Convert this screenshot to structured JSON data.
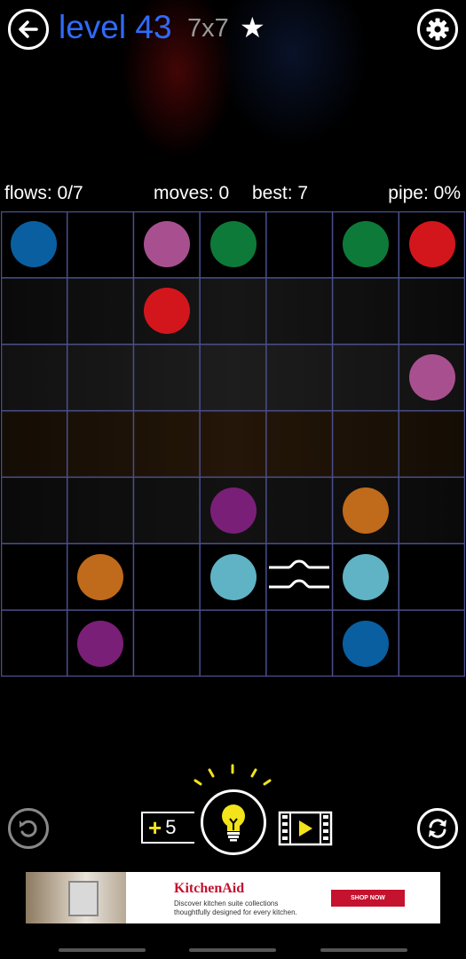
{
  "header": {
    "level_label": "level 43",
    "board_size": "7x7",
    "star": "★",
    "back_icon": "arrow-left-icon",
    "settings_icon": "gear-icon"
  },
  "stats": {
    "flows": "flows: 0/7",
    "moves": "moves: 0",
    "best": "best: 7",
    "pipe": "pipe: 0%"
  },
  "board": {
    "rows": 7,
    "cols": 7,
    "grid_color": "#4a4f8c",
    "bridge": {
      "row": 5,
      "col": 4
    },
    "dots": [
      {
        "color": "#0a5fa0",
        "row": 0,
        "col": 0
      },
      {
        "color": "#a8508f",
        "row": 0,
        "col": 2
      },
      {
        "color": "#0e7a3a",
        "row": 0,
        "col": 3
      },
      {
        "color": "#0e7a3a",
        "row": 0,
        "col": 5
      },
      {
        "color": "#d3161c",
        "row": 0,
        "col": 6
      },
      {
        "color": "#d3161c",
        "row": 1,
        "col": 2
      },
      {
        "color": "#a8508f",
        "row": 2,
        "col": 6
      },
      {
        "color": "#7a1f78",
        "row": 4,
        "col": 3
      },
      {
        "color": "#c06a1b",
        "row": 4,
        "col": 5
      },
      {
        "color": "#c06a1b",
        "row": 5,
        "col": 1
      },
      {
        "color": "#5fb3c5",
        "row": 5,
        "col": 3
      },
      {
        "color": "#5fb3c5",
        "row": 5,
        "col": 5
      },
      {
        "color": "#7a1f78",
        "row": 6,
        "col": 1
      },
      {
        "color": "#0a5fa0",
        "row": 6,
        "col": 5
      }
    ]
  },
  "controls": {
    "undo_icon": "undo-icon",
    "restart_icon": "restart-icon",
    "hint_plus": "+",
    "hint_count": "5",
    "hint_icon": "lightbulb-icon",
    "video_icon": "video-play-icon"
  },
  "ad": {
    "brand": "KitchenAid",
    "line1": "Discover kitchen suite collections",
    "line2": "thoughtfully designed for every kitchen.",
    "cta": "SHOP NOW"
  }
}
